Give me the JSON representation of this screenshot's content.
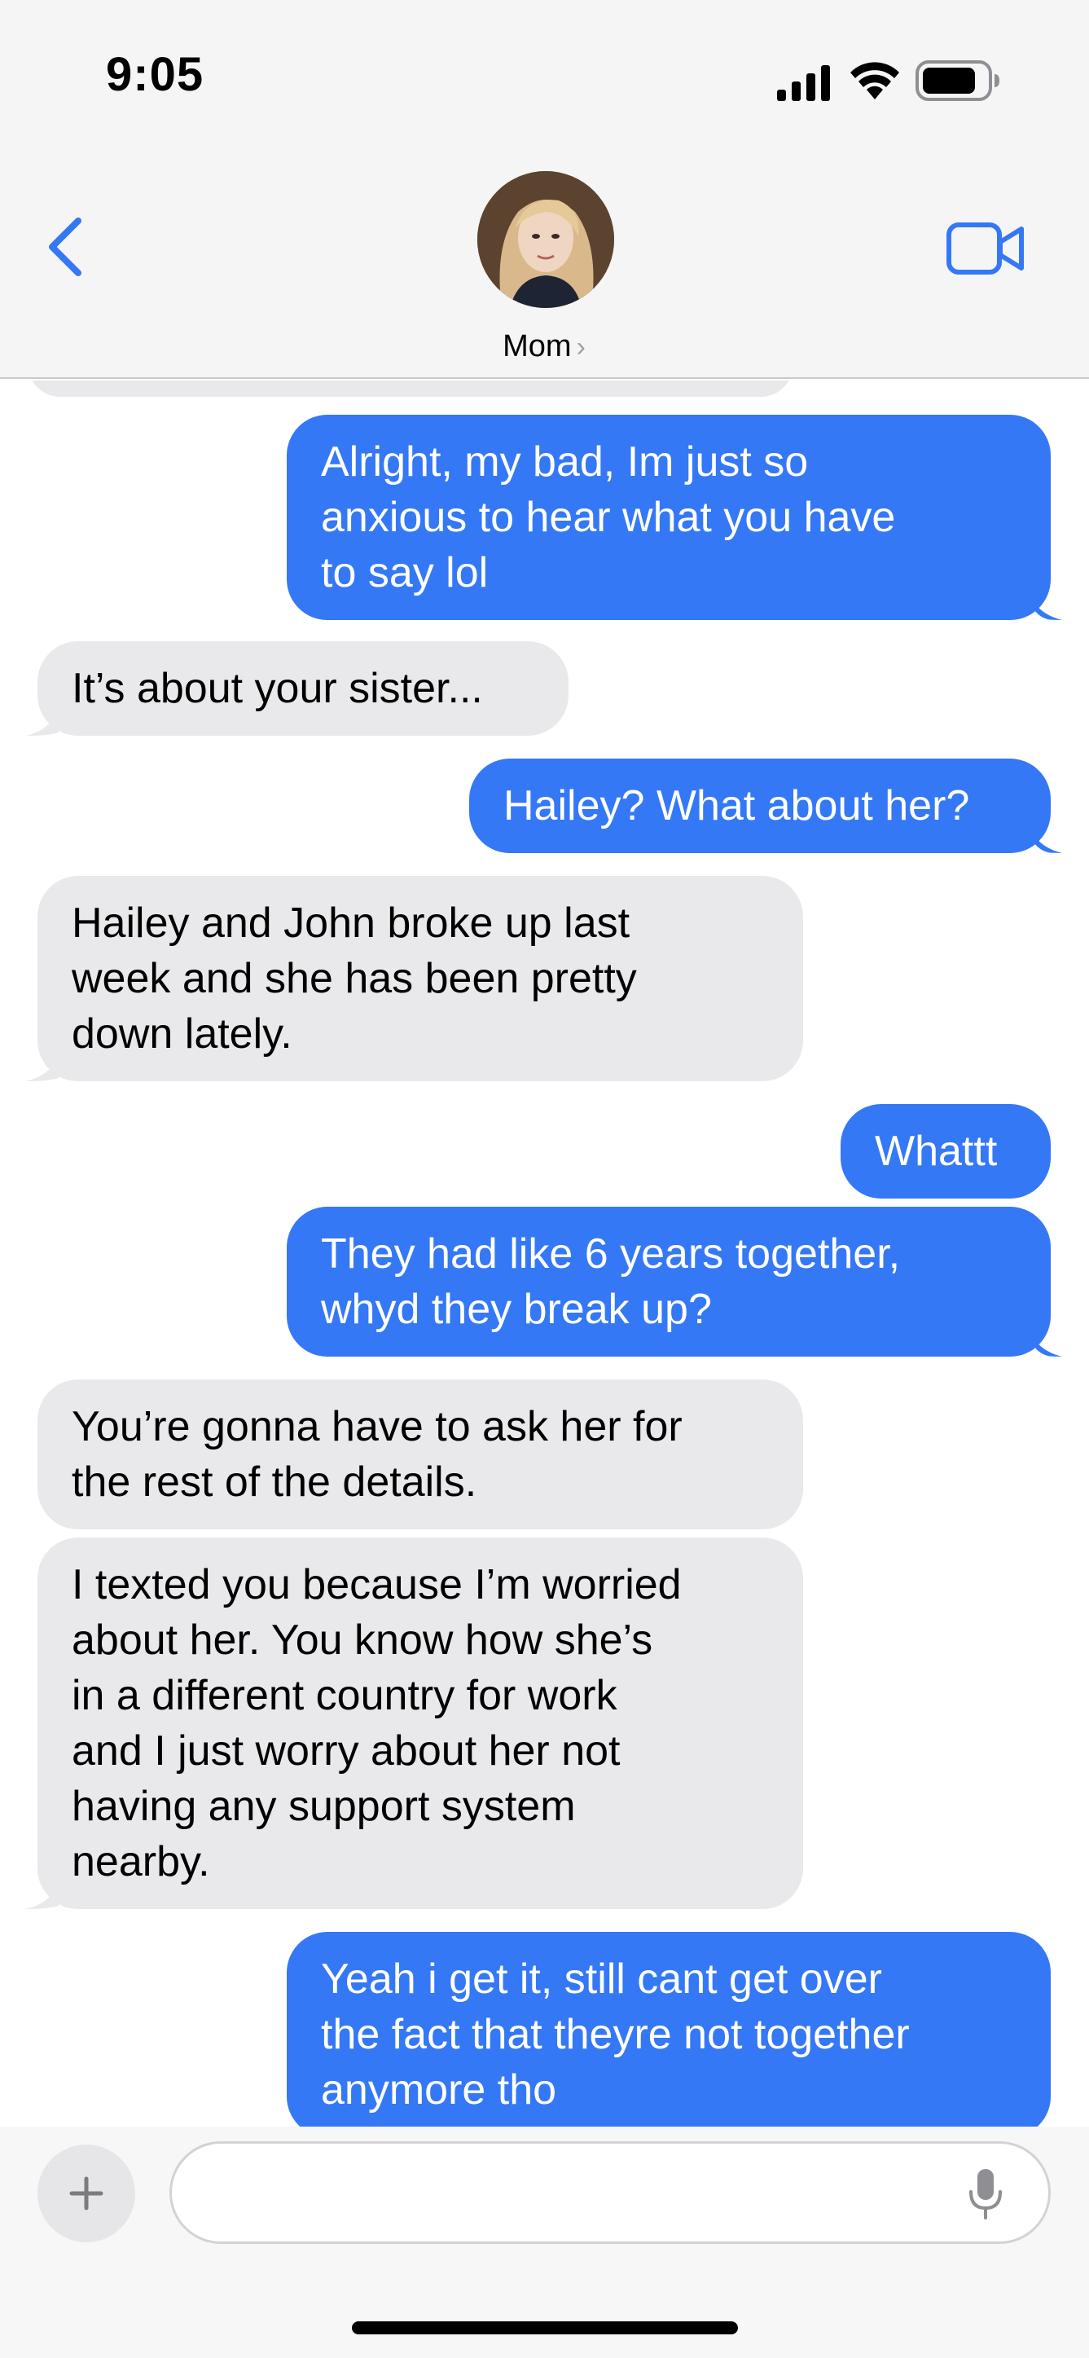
{
  "status_bar": {
    "time": "9:05"
  },
  "header": {
    "contact_name": "Mom",
    "chevron": "›",
    "icons": {
      "back": "chevron-left-icon",
      "video": "video-camera-icon"
    },
    "accent_color": "#3478f6"
  },
  "messages": [
    {
      "from": "me",
      "text": "Alright, my bad, Im just so\nanxious to hear what you have\nto say lol"
    },
    {
      "from": "them",
      "text": "It’s about your sister..."
    },
    {
      "from": "me",
      "text": "Hailey? What about her?"
    },
    {
      "from": "them",
      "text": "Hailey and John broke up last\nweek and she has been pretty\ndown lately."
    },
    {
      "from": "me",
      "text": "Whattt"
    },
    {
      "from": "me",
      "text": "They had like 6 years together,\nwhyd they break up?"
    },
    {
      "from": "them",
      "text": "You’re gonna have to ask her for\nthe rest of the details."
    },
    {
      "from": "them",
      "text": "I texted you because I’m worried\nabout her. You know how she’s\nin a different country for work\nand I just worry about her not\nhaving any support system\nnearby."
    },
    {
      "from": "me",
      "text": "Yeah i get it, still cant get over\nthe fact that theyre not together\nanymore tho"
    }
  ],
  "compose": {
    "value": "",
    "placeholder": "",
    "plus_label": "+",
    "icons": {
      "plus": "plus-icon",
      "mic": "microphone-icon"
    }
  },
  "colors": {
    "sent_bubble": "#3478f6",
    "received_bubble": "#e9e9eb",
    "header_bg": "#f5f5f6"
  }
}
